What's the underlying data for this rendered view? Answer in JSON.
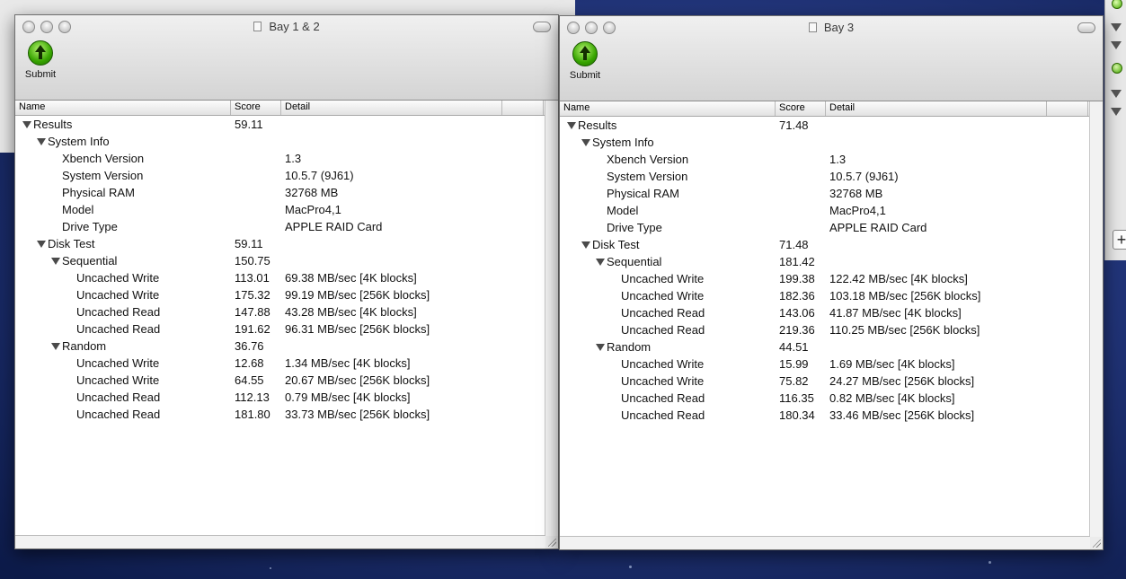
{
  "windows": [
    {
      "title": "Bay 1 & 2",
      "toolbar": {
        "submit_label": "Submit"
      },
      "columns": {
        "name": "Name",
        "score": "Score",
        "detail": "Detail"
      },
      "rows": [
        {
          "name": "Results",
          "score": "59.11",
          "detail": "",
          "level": 0,
          "group": true
        },
        {
          "name": "System Info",
          "score": "",
          "detail": "",
          "level": 1,
          "group": true
        },
        {
          "name": "Xbench Version",
          "score": "",
          "detail": "1.3",
          "level": 2,
          "group": false
        },
        {
          "name": "System Version",
          "score": "",
          "detail": "10.5.7 (9J61)",
          "level": 2,
          "group": false
        },
        {
          "name": "Physical RAM",
          "score": "",
          "detail": "32768 MB",
          "level": 2,
          "group": false
        },
        {
          "name": "Model",
          "score": "",
          "detail": "MacPro4,1",
          "level": 2,
          "group": false
        },
        {
          "name": "Drive Type",
          "score": "",
          "detail": "APPLE RAID Card",
          "level": 2,
          "group": false
        },
        {
          "name": "Disk Test",
          "score": "59.11",
          "detail": "",
          "level": 1,
          "group": true
        },
        {
          "name": "Sequential",
          "score": "150.75",
          "detail": "",
          "level": 2,
          "group": true
        },
        {
          "name": "Uncached Write",
          "score": "113.01",
          "detail": "69.38 MB/sec [4K blocks]",
          "level": 3,
          "group": false
        },
        {
          "name": "Uncached Write",
          "score": "175.32",
          "detail": "99.19 MB/sec [256K blocks]",
          "level": 3,
          "group": false
        },
        {
          "name": "Uncached Read",
          "score": "147.88",
          "detail": "43.28 MB/sec [4K blocks]",
          "level": 3,
          "group": false
        },
        {
          "name": "Uncached Read",
          "score": "191.62",
          "detail": "96.31 MB/sec [256K blocks]",
          "level": 3,
          "group": false
        },
        {
          "name": "Random",
          "score": "36.76",
          "detail": "",
          "level": 2,
          "group": true
        },
        {
          "name": "Uncached Write",
          "score": "12.68",
          "detail": "1.34 MB/sec [4K blocks]",
          "level": 3,
          "group": false
        },
        {
          "name": "Uncached Write",
          "score": "64.55",
          "detail": "20.67 MB/sec [256K blocks]",
          "level": 3,
          "group": false
        },
        {
          "name": "Uncached Read",
          "score": "112.13",
          "detail": "0.79 MB/sec [4K blocks]",
          "level": 3,
          "group": false
        },
        {
          "name": "Uncached Read",
          "score": "181.80",
          "detail": "33.73 MB/sec [256K blocks]",
          "level": 3,
          "group": false
        }
      ]
    },
    {
      "title": "Bay 3",
      "toolbar": {
        "submit_label": "Submit"
      },
      "columns": {
        "name": "Name",
        "score": "Score",
        "detail": "Detail"
      },
      "rows": [
        {
          "name": "Results",
          "score": "71.48",
          "detail": "",
          "level": 0,
          "group": true
        },
        {
          "name": "System Info",
          "score": "",
          "detail": "",
          "level": 1,
          "group": true
        },
        {
          "name": "Xbench Version",
          "score": "",
          "detail": "1.3",
          "level": 2,
          "group": false
        },
        {
          "name": "System Version",
          "score": "",
          "detail": "10.5.7 (9J61)",
          "level": 2,
          "group": false
        },
        {
          "name": "Physical RAM",
          "score": "",
          "detail": "32768 MB",
          "level": 2,
          "group": false
        },
        {
          "name": "Model",
          "score": "",
          "detail": "MacPro4,1",
          "level": 2,
          "group": false
        },
        {
          "name": "Drive Type",
          "score": "",
          "detail": "APPLE RAID Card",
          "level": 2,
          "group": false
        },
        {
          "name": "Disk Test",
          "score": "71.48",
          "detail": "",
          "level": 1,
          "group": true
        },
        {
          "name": "Sequential",
          "score": "181.42",
          "detail": "",
          "level": 2,
          "group": true
        },
        {
          "name": "Uncached Write",
          "score": "199.38",
          "detail": "122.42 MB/sec [4K blocks]",
          "level": 3,
          "group": false
        },
        {
          "name": "Uncached Write",
          "score": "182.36",
          "detail": "103.18 MB/sec [256K blocks]",
          "level": 3,
          "group": false
        },
        {
          "name": "Uncached Read",
          "score": "143.06",
          "detail": "41.87 MB/sec [4K blocks]",
          "level": 3,
          "group": false
        },
        {
          "name": "Uncached Read",
          "score": "219.36",
          "detail": "110.25 MB/sec [256K blocks]",
          "level": 3,
          "group": false
        },
        {
          "name": "Random",
          "score": "44.51",
          "detail": "",
          "level": 2,
          "group": true
        },
        {
          "name": "Uncached Write",
          "score": "15.99",
          "detail": "1.69 MB/sec [4K blocks]",
          "level": 3,
          "group": false
        },
        {
          "name": "Uncached Write",
          "score": "75.82",
          "detail": "24.27 MB/sec [256K blocks]",
          "level": 3,
          "group": false
        },
        {
          "name": "Uncached Read",
          "score": "116.35",
          "detail": "0.82 MB/sec [4K blocks]",
          "level": 3,
          "group": false
        },
        {
          "name": "Uncached Read",
          "score": "180.34",
          "detail": "33.46 MB/sec [256K blocks]",
          "level": 3,
          "group": false
        }
      ]
    }
  ]
}
